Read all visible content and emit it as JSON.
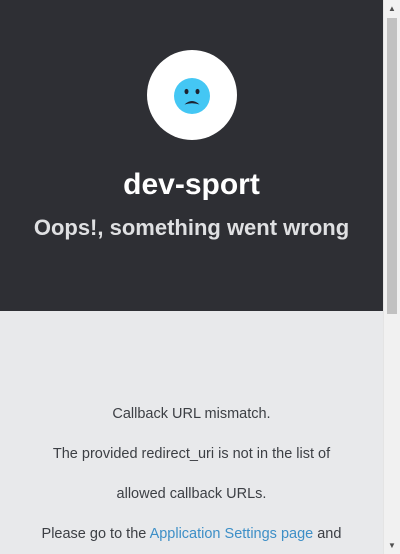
{
  "header": {
    "app_name": "dev-sport",
    "error_title": "Oops!, something went wrong",
    "icon": "sad-face-icon",
    "background_color": "#2e2f34"
  },
  "body": {
    "line1": "Callback URL mismatch.",
    "line2": "The provided redirect_uri is not in the list of",
    "line3": "allowed callback URLs.",
    "line4_prefix": "Please go to the ",
    "line4_link": "Application Settings page",
    "line4_suffix": " and"
  },
  "colors": {
    "accent_link": "#3d8fc7",
    "face": "#44c7f4",
    "body_background": "#e8e9eb"
  }
}
